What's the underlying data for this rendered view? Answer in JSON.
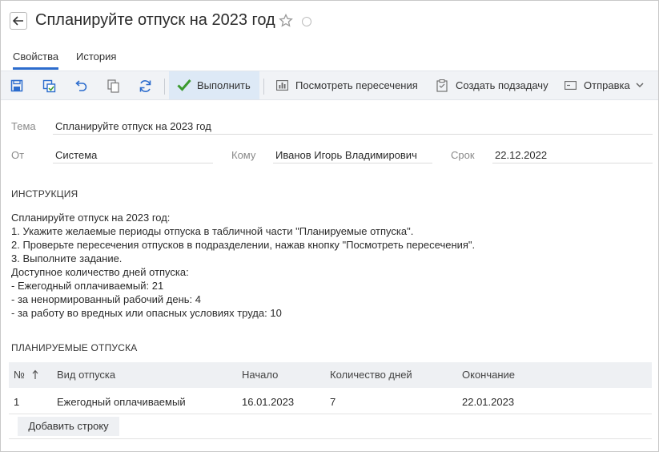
{
  "header": {
    "title": "Спланируйте отпуск на 2023 год"
  },
  "tabs": [
    {
      "label": "Свойства",
      "active": true
    },
    {
      "label": "История",
      "active": false
    }
  ],
  "toolbar": {
    "execute_label": "Выполнить",
    "view_intersections_label": "Посмотреть пересечения",
    "create_subtask_label": "Создать подзадачу",
    "send_label": "Отправка"
  },
  "form": {
    "subject_label": "Тема",
    "subject_value": "Спланируйте отпуск на 2023 год",
    "from_label": "От",
    "from_value": "Система",
    "to_label": "Кому",
    "to_value": "Иванов Игорь Владимирович",
    "due_label": "Срок",
    "due_value": "22.12.2022"
  },
  "instruction": {
    "heading": "ИНСТРУКЦИЯ",
    "lines": [
      "Спланируйте отпуск на 2023 год:",
      "1. Укажите желаемые периоды отпуска в табличной части \"Планируемые отпуска\".",
      "2. Проверьте пересечения отпусков в подразделении, нажав кнопку \"Посмотреть пересечения\".",
      "3. Выполните задание.",
      "Доступное количество дней отпуска:",
      "- Ежегодный оплачиваемый: 21",
      "- за ненормированный рабочий день: 4",
      "- за работу во вредных или опасных условиях труда: 10"
    ]
  },
  "vacations": {
    "heading": "ПЛАНИРУЕМЫЕ ОТПУСКА",
    "columns": {
      "num": "№",
      "type": "Вид отпуска",
      "start": "Начало",
      "days": "Количество дней",
      "end": "Окончание"
    },
    "rows": [
      {
        "num": "1",
        "type": "Ежегодный оплачиваемый",
        "start": "16.01.2023",
        "days": "7",
        "end": "22.01.2023"
      }
    ],
    "add_row_label": "Добавить строку"
  },
  "colors": {
    "accent": "#2c6ccd",
    "execute_check": "#3a9a2e",
    "toolbar_icon": "#2c6ccd"
  }
}
